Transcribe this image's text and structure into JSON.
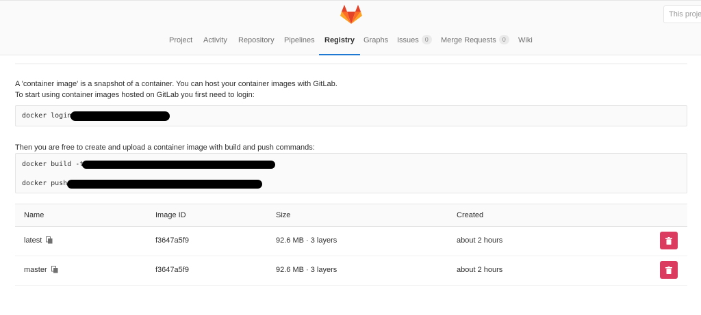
{
  "search": {
    "placeholder": "This project"
  },
  "nav": {
    "items": [
      {
        "label": "Project"
      },
      {
        "label": "Activity"
      },
      {
        "label": "Repository"
      },
      {
        "label": "Pipelines"
      },
      {
        "label": "Registry",
        "active": true
      },
      {
        "label": "Graphs"
      },
      {
        "label": "Issues",
        "count": "0"
      },
      {
        "label": "Merge Requests",
        "count": "0"
      },
      {
        "label": "Wiki"
      }
    ]
  },
  "intro": {
    "line1": "A 'container image' is a snapshot of a container. You can host your container images with GitLab.",
    "line2": "To start using container images hosted on GitLab you first need to login:"
  },
  "login_cmd": "docker login",
  "build_intro": "Then you are free to create and upload a container image with build and push commands:",
  "build_cmd": "docker build -t",
  "push_cmd": "docker push",
  "table": {
    "headers": {
      "name": "Name",
      "image_id": "Image ID",
      "size": "Size",
      "created": "Created"
    },
    "rows": [
      {
        "name": "latest",
        "image_id": "f3647a5f9",
        "size": "92.6 MB · 3 layers",
        "created": "about 2 hours"
      },
      {
        "name": "master",
        "image_id": "f3647a5f9",
        "size": "92.6 MB · 3 layers",
        "created": "about 2 hours"
      }
    ]
  },
  "colors": {
    "accent": "#1f78d1",
    "danger": "#db3b5e",
    "logo": "#e24329"
  }
}
